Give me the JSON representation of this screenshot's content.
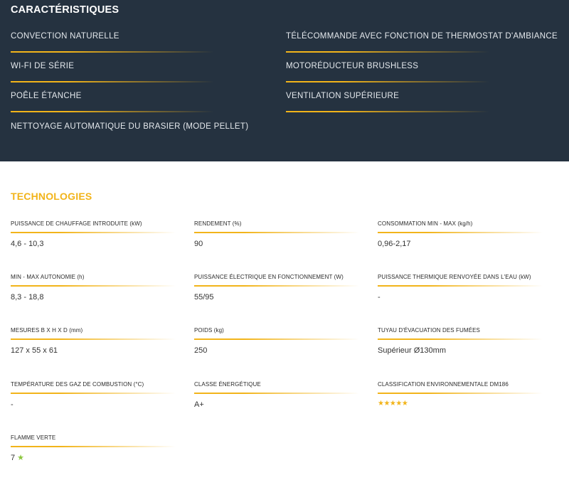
{
  "caracteristiques": {
    "title": "CARACTÉRISTIQUES",
    "items": [
      "CONVECTION NATURELLE",
      "TÉLÉCOMMANDE AVEC FONCTION DE THERMOSTAT D'AMBIANCE",
      "WI-FI DE SÉRIE",
      "MOTORÉDUCTEUR BRUSHLESS",
      "POÊLE ÉTANCHE",
      "VENTILATION SUPÉRIEURE",
      "NETTOYAGE AUTOMATIQUE DU BRASIER (MODE PELLET)"
    ]
  },
  "technologies": {
    "title": "TECHNOLOGIES",
    "specs": [
      {
        "label": "PUISSANCE DE CHAUFFAGE INTRODUITE (kW)",
        "value": "4,6 - 10,3"
      },
      {
        "label": "RENDEMENT (%)",
        "value": "90"
      },
      {
        "label": "CONSOMMATION MIN - MAX (kg/h)",
        "value": "0,96-2,17"
      },
      {
        "label": "MIN - MAX AUTONOMIE (h)",
        "value": "8,3 - 18,8"
      },
      {
        "label": "PUISSANCE ÉLECTRIQUE EN FONCTIONNEMENT (W)",
        "value": "55/95"
      },
      {
        "label": "PUISSANCE THERMIQUE RENVOYÉE DANS L'EAU (kW)",
        "value": "-"
      },
      {
        "label": "MESURES B X H X D (mm)",
        "value": "127 x 55 x 61"
      },
      {
        "label": "POIDS (kg)",
        "value": "250"
      },
      {
        "label": "TUYAU D'ÉVACUATION DES FUMÉES",
        "value": "Supérieur Ø130mm"
      },
      {
        "label": "TEMPÉRATURE DES GAZ DE COMBUSTION (°C)",
        "value": "-"
      },
      {
        "label": "CLASSE ÉNERGÉTIQUE",
        "value": "A+"
      },
      {
        "label": "CLASSIFICATION ENVIRONNEMENTALE DM186",
        "value": "★★★★★",
        "rating": 5
      },
      {
        "label": "FLAMME VERTE",
        "value": "7",
        "icon": "green-star-icon",
        "icon_glyph": "★"
      }
    ]
  },
  "colors": {
    "dark_bg": "#253240",
    "accent": "#f2b41a",
    "green": "#8cc63f"
  }
}
